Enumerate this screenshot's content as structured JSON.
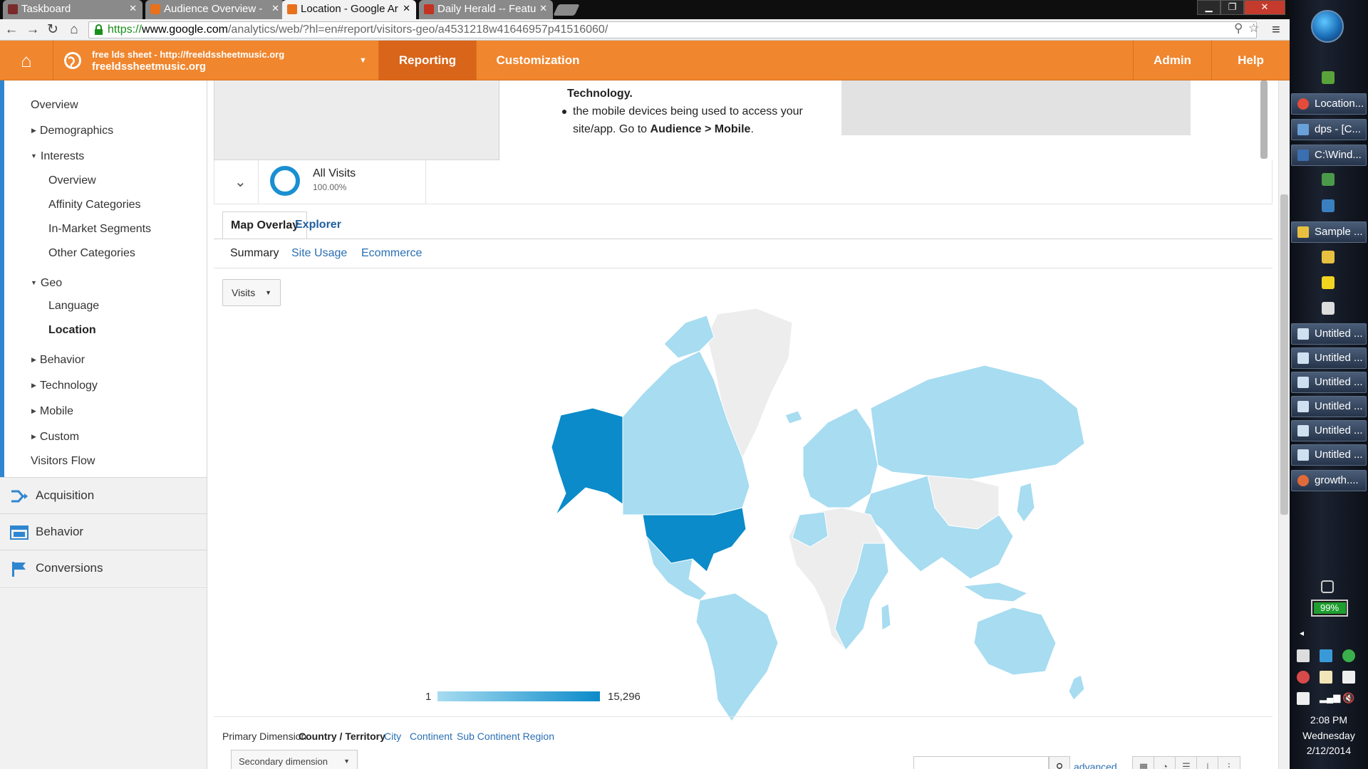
{
  "browser": {
    "tabs": [
      {
        "title": "Taskboard",
        "color": "#7a2a2a"
      },
      {
        "title": "Audience Overview -",
        "color": "#e8711c"
      },
      {
        "title": "Location - Google Ar",
        "color": "#e8711c"
      },
      {
        "title": "Daily Herald -- Featu",
        "color": "#c23321"
      }
    ],
    "url_scheme": "https://",
    "url_host": "www.google.com",
    "url_path": "/analytics/web/?hl=en#report/visitors-geo/a4531218w41646957p41516060/"
  },
  "ga_header": {
    "account_line1": "free lds sheet - http://freeldssheetmusic.org",
    "account_line2": "freeldssheetmusic.org",
    "nav": {
      "reporting": "Reporting",
      "customization": "Customization",
      "admin": "Admin",
      "help": "Help"
    },
    "brand_color": "#f0862e"
  },
  "sidebar": {
    "overview": "Overview",
    "demographics": "Demographics",
    "interests": "Interests",
    "interests_items": [
      "Overview",
      "Affinity Categories",
      "In-Market Segments",
      "Other Categories"
    ],
    "geo": "Geo",
    "geo_items": [
      "Language",
      "Location"
    ],
    "behavior": "Behavior",
    "technology": "Technology",
    "mobile": "Mobile",
    "custom": "Custom",
    "visitors_flow": "Visitors Flow",
    "sections": [
      "Acquisition",
      "Behavior",
      "Conversions"
    ]
  },
  "intro": {
    "line_technology": "Technology",
    "bullet_1a": "the mobile devices being used to access your",
    "bullet_1b_prefix": "site/app. Go to ",
    "bullet_1b_bold": "Audience > Mobile"
  },
  "segment": {
    "name": "All Visits",
    "percent": "100.00%"
  },
  "view_tabs": {
    "map_overlay": "Map Overlay",
    "explorer": "Explorer"
  },
  "sub_tabs": {
    "summary": "Summary",
    "site_usage": "Site Usage",
    "ecommerce": "Ecommerce"
  },
  "metric_select": "Visits",
  "legend": {
    "min": "1",
    "max": "15,296",
    "low_color": "#a7dcf1",
    "high_color": "#0b8bc9"
  },
  "primary_dimension": {
    "label": "Primary Dimension:",
    "active": "Country / Territory",
    "options": [
      "City",
      "Continent",
      "Sub Continent Region"
    ]
  },
  "table_controls": {
    "secondary_dimension": "Secondary dimension",
    "advanced": "advanced"
  },
  "taskbar": {
    "items": [
      "Location...",
      "dps - [C...",
      "C:\\Wind...",
      "Sample ...",
      "Untitled ...",
      "Untitled ...",
      "Untitled ...",
      "Untitled ...",
      "Untitled ...",
      "Untitled ...",
      "growth...."
    ],
    "battery": "99%",
    "time": "2:08 PM",
    "day": "Wednesday",
    "date": "2/12/2014"
  }
}
